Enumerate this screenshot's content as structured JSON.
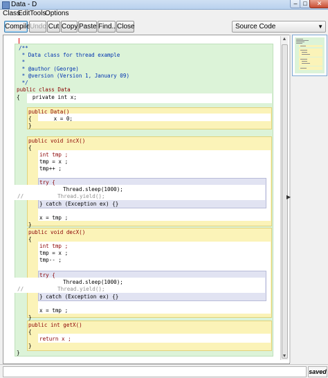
{
  "window": {
    "title": "Data - D"
  },
  "menu": [
    "Class",
    "Edit",
    "Tools",
    "Options"
  ],
  "toolbar": {
    "buttons": [
      "Compile",
      "Undo",
      "Cut",
      "Copy",
      "Paste",
      "Find...",
      "Close"
    ],
    "view_select": "Source Code"
  },
  "editor": {
    "lines": [
      "/**",
      " * Data class for thread example",
      " *",
      " * @author (George)",
      " * @version (Version 1, January 09)",
      " */",
      "public class Data",
      "{    private int x;",
      "public Data()",
      "{       x = 0;",
      "}",
      "public void incX()",
      "{",
      "int tmp ;",
      "tmp = x ;",
      "tmp++ ;",
      "try {",
      "Thread.sleep(1000);",
      "//",
      "Thread.yield();",
      "} catch (Exception ex) {}",
      "x = tmp ;",
      "}",
      "public void decX()",
      "{",
      "int tmp ;",
      "tmp = x ;",
      "tmp-- ;",
      "try {",
      "Thread.sleep(1000);",
      "//",
      "Thread.yield();",
      "} catch (Exception ex) {}",
      "x = tmp ;",
      "}",
      "public int getX()",
      "{",
      "return x ;",
      "}",
      "}"
    ]
  },
  "status": {
    "message": "",
    "state": "saved"
  }
}
